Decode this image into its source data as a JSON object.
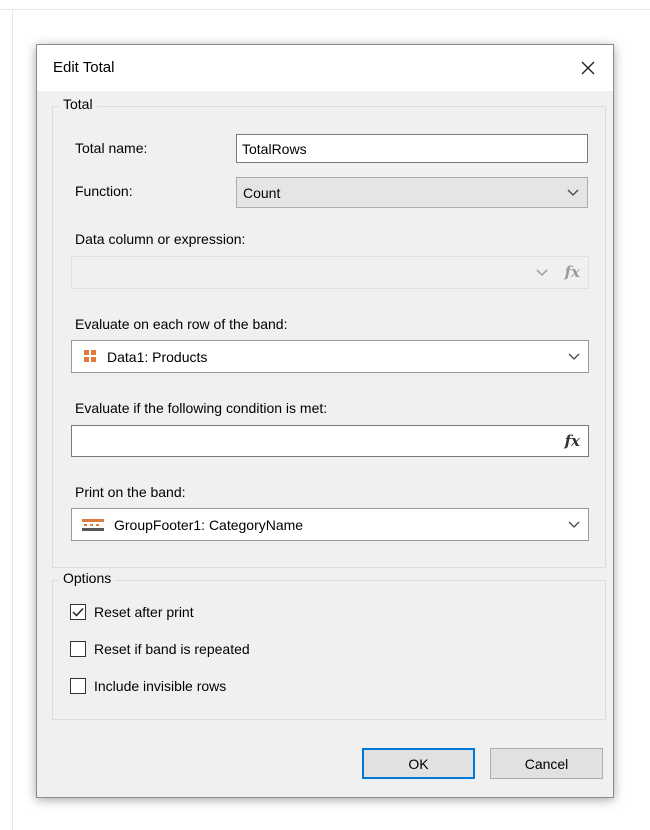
{
  "dialog": {
    "title": "Edit Total",
    "close_glyph": "✕"
  },
  "total_group": {
    "legend": "Total",
    "total_name_label": "Total name:",
    "total_name_value": "TotalRows",
    "function_label": "Function:",
    "function_value": "Count",
    "data_column_label": "Data column or expression:",
    "data_column_value": "",
    "evaluate_band_label": "Evaluate on each row of the band:",
    "evaluate_band_value": "Data1: Products",
    "condition_label": "Evaluate if the following condition is met:",
    "condition_value": "",
    "print_band_label": "Print on the band:",
    "print_band_value": "GroupFooter1: CategoryName",
    "fx_glyph": "fx"
  },
  "options_group": {
    "legend": "Options",
    "checkboxes": [
      {
        "label": "Reset after print",
        "checked": true
      },
      {
        "label": "Reset if band is repeated",
        "checked": false
      },
      {
        "label": "Include invisible rows",
        "checked": false
      }
    ]
  },
  "buttons": {
    "ok": "OK",
    "cancel": "Cancel"
  },
  "colors": {
    "accent": "#0078d7",
    "data_band_icon": "#e07b39"
  },
  "icons": {
    "close": "close-icon",
    "chevron": "chevron-down-icon",
    "fx": "fx-expression-icon",
    "data_band": "data-band-icon",
    "group_footer": "group-footer-band-icon",
    "check": "checkmark-icon"
  }
}
